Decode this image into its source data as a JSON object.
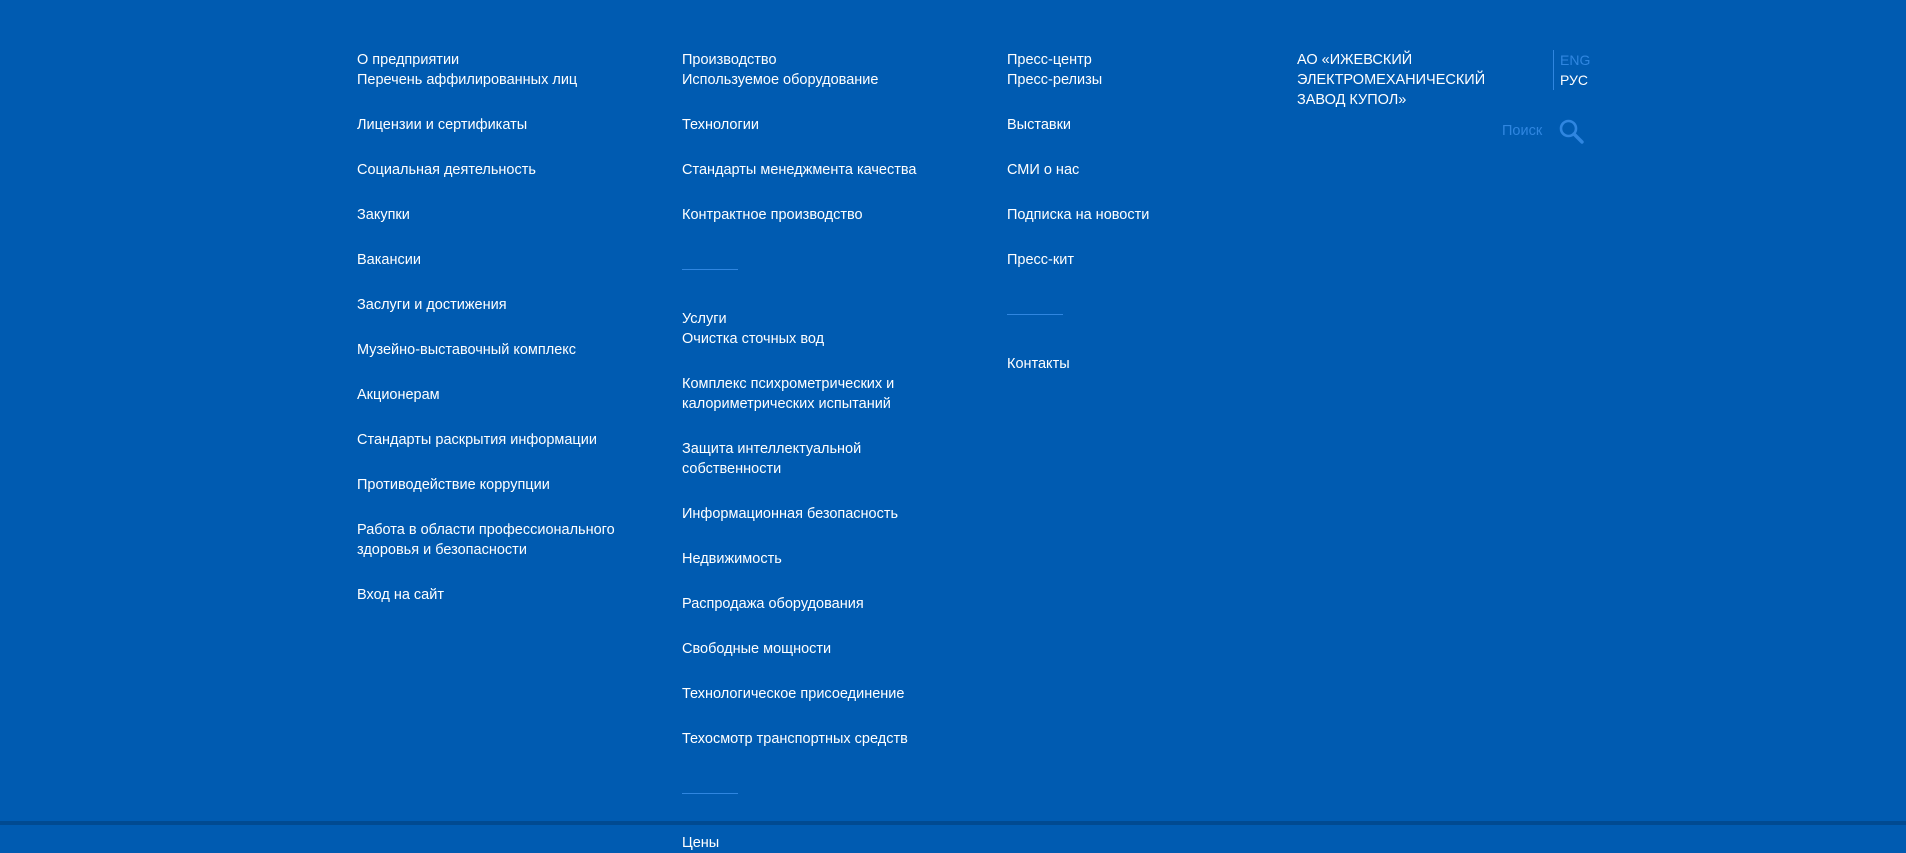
{
  "company": {
    "name": "АО «ИЖЕВСКИЙ ЭЛЕКТРОМЕХАНИЧЕСКИЙ ЗАВОД КУПОЛ»"
  },
  "language": {
    "eng": "ENG",
    "rus": "РУС"
  },
  "search": {
    "label": "Поиск",
    "icon": "search-icon"
  },
  "colors": {
    "background": "#005bb1",
    "accent": "#2f86e0",
    "text": "#ffffff"
  },
  "about": {
    "title": "О предприятии",
    "items": [
      "Перечень аффилированных лиц",
      "Лицензии и сертификаты",
      "Социальная деятельность",
      "Закупки",
      "Вакансии",
      "Заслуги и достижения",
      "Музейно-выставочный комплекс",
      "Акционерам",
      "Стандарты раскрытия информации",
      "Противодействие коррупции",
      "Работа в области профессионального здоровья и безопасности",
      "Вход на сайт"
    ]
  },
  "production": {
    "title": "Производство",
    "items": [
      "Используемое оборудование",
      "Технологии",
      "Стандарты менеджмента качества",
      "Контрактное производство"
    ]
  },
  "services": {
    "title": "Услуги",
    "items": [
      "Очистка сточных вод",
      "Комплекс психрометрических и калориметрических испытаний",
      "Защита интеллектуальной собственности",
      "Информационная безопасность",
      "Недвижимость",
      "Распродажа оборудования",
      "Свободные мощности",
      "Технологическое присоединение",
      "Техосмотр транспортных средств"
    ]
  },
  "prices": {
    "title": "Цены"
  },
  "press": {
    "title": "Пресс-центр",
    "items": [
      "Пресс-релизы",
      "Выставки",
      "СМИ о нас",
      "Подписка на новости",
      "Пресс-кит"
    ]
  },
  "contacts": {
    "title": "Контакты"
  }
}
